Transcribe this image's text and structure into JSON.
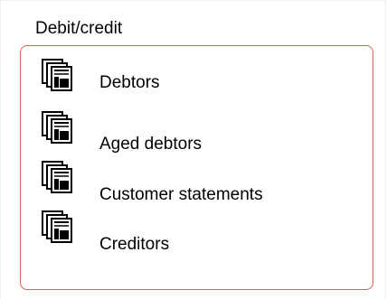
{
  "group": {
    "title": "Debit/credit",
    "border_color": "#d9634e"
  },
  "reports": [
    {
      "label": "Debtors",
      "icon": "report-stack-icon"
    },
    {
      "label": "Aged debtors",
      "icon": "report-stack-icon"
    },
    {
      "label": "Customer statements",
      "icon": "report-stack-icon"
    },
    {
      "label": "Creditors",
      "icon": "report-stack-icon"
    }
  ]
}
